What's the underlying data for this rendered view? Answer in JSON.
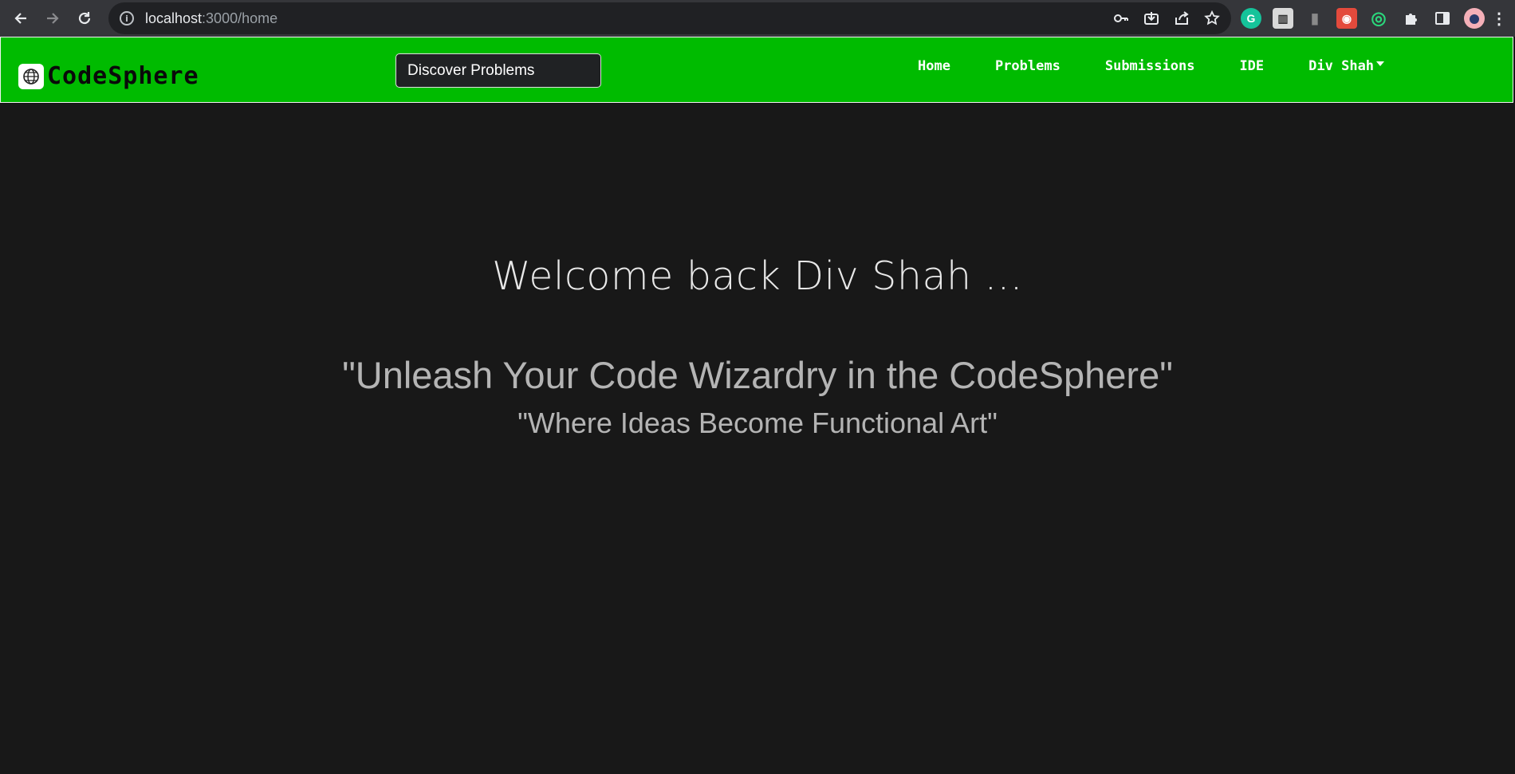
{
  "browser": {
    "url_host": "localhost",
    "url_rest": ":3000/home",
    "icons": {
      "back": "arrow-left-icon",
      "forward": "arrow-right-icon",
      "reload": "reload-icon",
      "site_info": "info-icon",
      "password": "key-icon",
      "install": "install-app-icon",
      "share": "share-icon",
      "bookmark": "star-icon",
      "extensions": "puzzle-icon",
      "side_panel": "side-panel-icon",
      "menu": "kebab-menu-icon"
    },
    "extensions": [
      {
        "name": "grammarly-extension-icon",
        "glyph": "G",
        "color": "#15c39a"
      },
      {
        "name": "toolbar-extension-icon",
        "glyph": "▥",
        "color": "#d0d0d0"
      },
      {
        "name": "bottle-extension-icon",
        "glyph": "▮",
        "color": "#8a8a8a"
      },
      {
        "name": "panda-extension-icon",
        "glyph": "🐼",
        "color": "#e34a3c"
      },
      {
        "name": "target-extension-icon",
        "glyph": "◎",
        "color": "#2bd67b"
      }
    ]
  },
  "navbar": {
    "brand": "CodeSphere",
    "search_label": "Discover Problems",
    "links": [
      "Home",
      "Problems",
      "Submissions",
      "IDE"
    ],
    "user": "Div Shah",
    "accent_color": "#00bb00"
  },
  "hero": {
    "welcome": "Welcome back Div Shah ...",
    "tagline": "\"Unleash Your Code Wizardry in the CodeSphere\"",
    "subtagline": "\"Where Ideas Become Functional Art\""
  }
}
